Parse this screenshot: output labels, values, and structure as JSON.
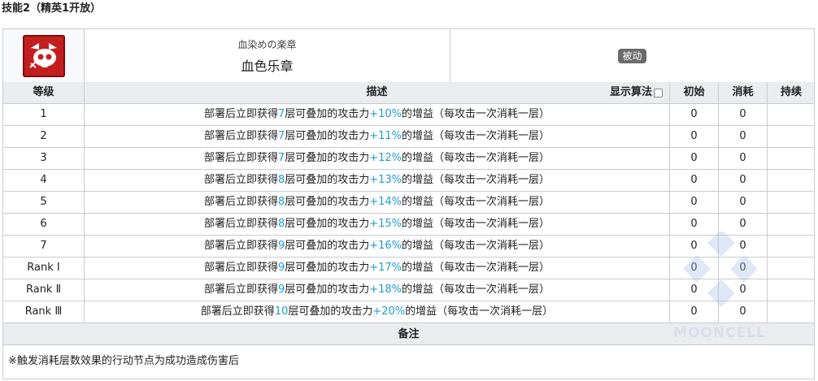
{
  "section": {
    "title": "技能2（精英1开放）"
  },
  "skill": {
    "icon": "red-skull-skill-icon",
    "name_jp": "血染めの楽章",
    "name_cn": "血色乐章",
    "type_badge": "被动"
  },
  "table": {
    "headers": {
      "level": "等级",
      "desc": "描述",
      "algo": "显示算法",
      "init": "初始",
      "cost": "消耗",
      "duration": "持续"
    },
    "rows": [
      {
        "level": "1",
        "pre": "部署后立即获得",
        "stacks": "7",
        "mid": "层可叠加的攻击力",
        "bonus": "+10%",
        "post": "的增益（每攻击一次消耗一层）",
        "init": "0",
        "cost": "0",
        "duration": ""
      },
      {
        "level": "2",
        "pre": "部署后立即获得",
        "stacks": "7",
        "mid": "层可叠加的攻击力",
        "bonus": "+11%",
        "post": "的增益（每攻击一次消耗一层）",
        "init": "0",
        "cost": "0",
        "duration": ""
      },
      {
        "level": "3",
        "pre": "部署后立即获得",
        "stacks": "7",
        "mid": "层可叠加的攻击力",
        "bonus": "+12%",
        "post": "的增益（每攻击一次消耗一层）",
        "init": "0",
        "cost": "0",
        "duration": ""
      },
      {
        "level": "4",
        "pre": "部署后立即获得",
        "stacks": "8",
        "mid": "层可叠加的攻击力",
        "bonus": "+13%",
        "post": "的增益（每攻击一次消耗一层）",
        "init": "0",
        "cost": "0",
        "duration": ""
      },
      {
        "level": "5",
        "pre": "部署后立即获得",
        "stacks": "8",
        "mid": "层可叠加的攻击力",
        "bonus": "+14%",
        "post": "的增益（每攻击一次消耗一层）",
        "init": "0",
        "cost": "0",
        "duration": ""
      },
      {
        "level": "6",
        "pre": "部署后立即获得",
        "stacks": "8",
        "mid": "层可叠加的攻击力",
        "bonus": "+15%",
        "post": "的增益（每攻击一次消耗一层）",
        "init": "0",
        "cost": "0",
        "duration": ""
      },
      {
        "level": "7",
        "pre": "部署后立即获得",
        "stacks": "9",
        "mid": "层可叠加的攻击力",
        "bonus": "+16%",
        "post": "的增益（每攻击一次消耗一层）",
        "init": "0",
        "cost": "0",
        "duration": ""
      },
      {
        "level": "Rank Ⅰ",
        "pre": "部署后立即获得",
        "stacks": "9",
        "mid": "层可叠加的攻击力",
        "bonus": "+17%",
        "post": "的增益（每攻击一次消耗一层）",
        "init": "0",
        "cost": "0",
        "duration": ""
      },
      {
        "level": "Rank Ⅱ",
        "pre": "部署后立即获得",
        "stacks": "9",
        "mid": "层可叠加的攻击力",
        "bonus": "+18%",
        "post": "的增益（每攻击一次消耗一层）",
        "init": "0",
        "cost": "0",
        "duration": ""
      },
      {
        "level": "Rank Ⅲ",
        "pre": "部署后立即获得",
        "stacks": "10",
        "mid": "层可叠加的攻击力",
        "bonus": "+20%",
        "post": "的增益（每攻击一次消耗一层）",
        "init": "0",
        "cost": "0",
        "duration": ""
      }
    ]
  },
  "notes": {
    "title": "备注",
    "text": "※触发消耗层数效果的行动节点为成功造成伤害后"
  },
  "watermark": {
    "text": "MOONCELL"
  },
  "colors": {
    "highlight": "#1e9bd7",
    "skill_icon_bg": "#c41f1f",
    "badge_bg": "#6b6b6b"
  }
}
